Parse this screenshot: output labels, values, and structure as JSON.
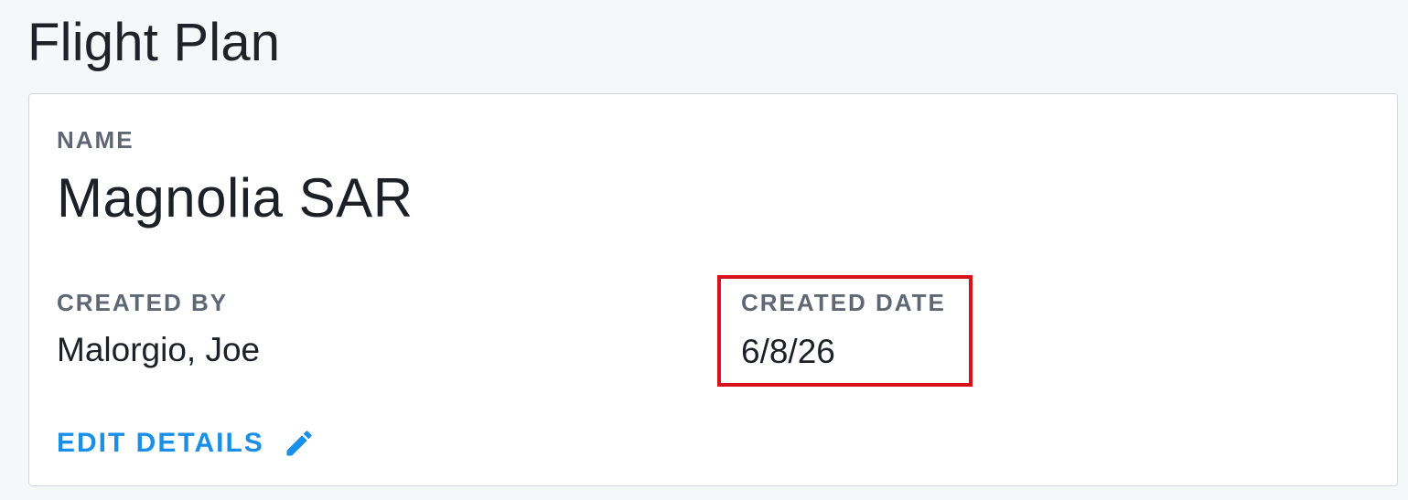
{
  "page": {
    "title": "Flight Plan"
  },
  "details": {
    "name_label": "NAME",
    "name_value": "Magnolia SAR",
    "created_by_label": "CREATED BY",
    "created_by_value": "Malorgio, Joe",
    "created_date_label": "CREATED DATE",
    "created_date_value": "6/8/26"
  },
  "actions": {
    "edit_label": "EDIT DETAILS",
    "edit_icon": "pencil-icon"
  },
  "colors": {
    "accent": "#1a8fe8",
    "highlight": "#d8111b"
  }
}
